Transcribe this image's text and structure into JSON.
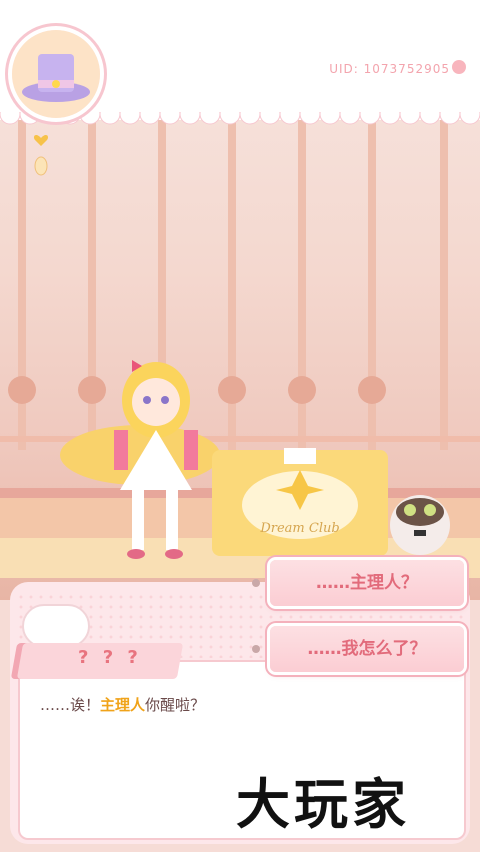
{
  "header": {
    "uid_text": "UID: 1073752905"
  },
  "dialog": {
    "speaker": "? ? ?",
    "line_prefix": "……诶！",
    "line_highlight": "主理人",
    "line_suffix": "你醒啦？"
  },
  "choices": [
    {
      "label": "……主理人？"
    },
    {
      "label": "……我怎么了？"
    }
  ],
  "scene": {
    "box_label": "Dream Club"
  },
  "watermark": "大玩家",
  "colors": {
    "accent": "#e26b7b",
    "highlight": "#f0a31a",
    "lace": "#f7c6cf"
  }
}
